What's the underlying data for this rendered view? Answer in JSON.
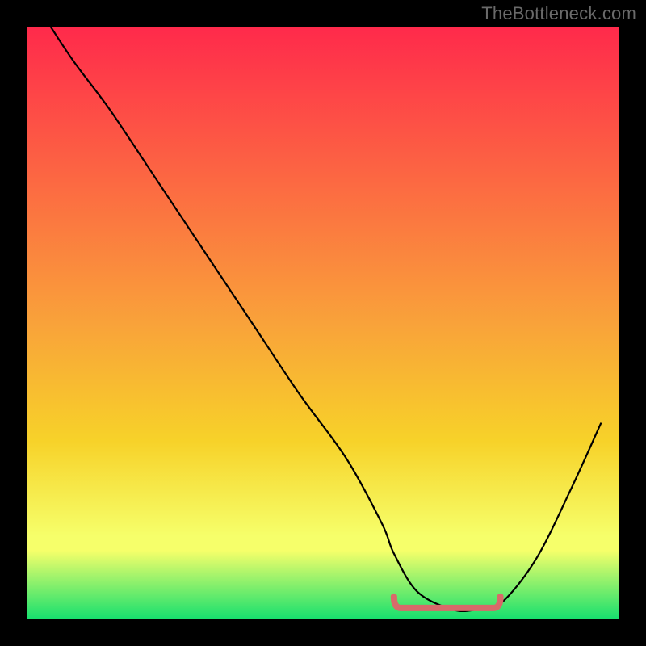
{
  "watermark": "TheBottleneck.com",
  "colors": {
    "bg": "#000000",
    "watermark": "#6a6a6a",
    "curve": "#000000",
    "min_marker": "#d86a6a",
    "grad_top": "#ff2a4b",
    "grad_mid": "#f7d229",
    "grad_band_top": "#f6ff6a",
    "grad_bottom": "#18e06e"
  },
  "chart_data": {
    "type": "line",
    "title": "",
    "xlabel": "",
    "ylabel": "",
    "xlim": [
      0,
      100
    ],
    "ylim": [
      0,
      100
    ],
    "x": [
      4,
      8,
      14,
      22,
      30,
      38,
      46,
      54,
      60,
      62,
      66,
      72,
      76,
      80,
      86,
      92,
      97
    ],
    "values": [
      100,
      94,
      86,
      74,
      62,
      50,
      38,
      27,
      16,
      11,
      4.5,
      1.5,
      1.5,
      2.5,
      10,
      22,
      33
    ],
    "min_band": {
      "x_start": 62,
      "x_end": 80,
      "y": 1.8
    }
  }
}
